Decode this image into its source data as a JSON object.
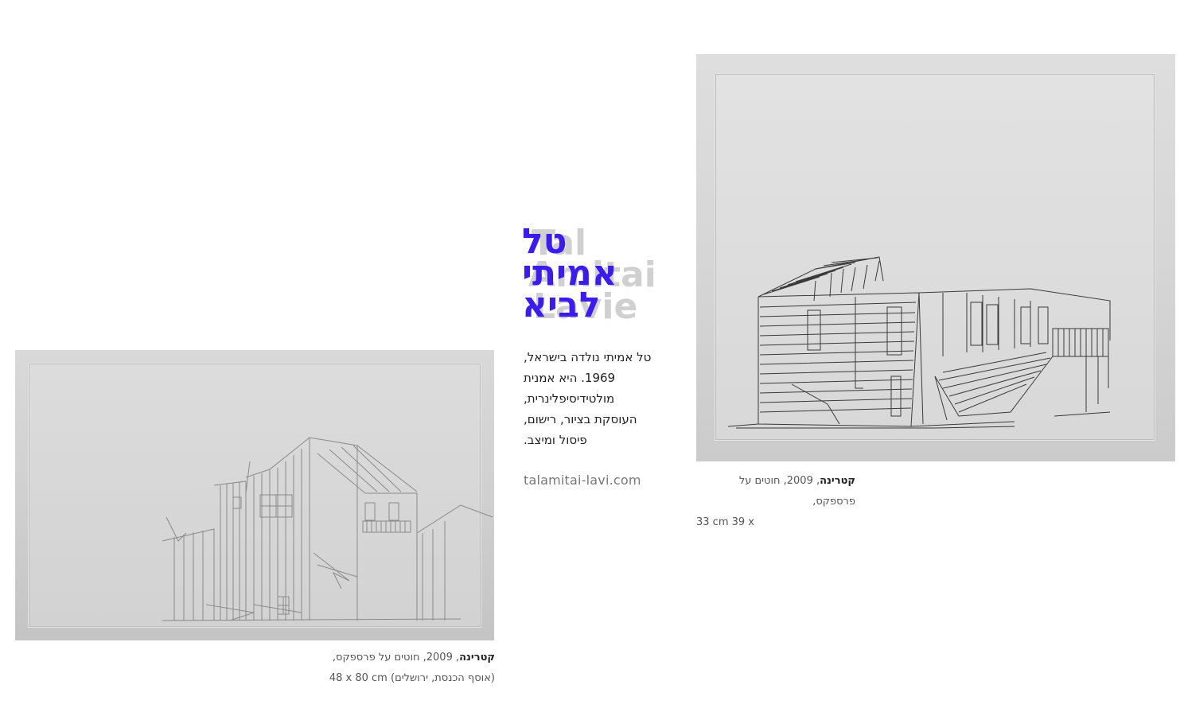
{
  "artist": {
    "name_lines": [
      "טל",
      "אמיתי",
      "לביא"
    ],
    "name_latin_lines": [
      "Tal",
      "Amitai",
      "Lavie"
    ],
    "bio_lines": [
      "טל אמיתי נולדה בישראל,",
      "1969. היא אמנית",
      "מולטידיסיפלינרית,",
      "העוסקת בציור, רישום,",
      "פיסול ומיצב."
    ],
    "website": "talamitai-lavi.com"
  },
  "artworks": [
    {
      "title": "קטרינה",
      "details": ", 2009, חוטים על פרספקס,",
      "size_line": "48 x 80 cm (אוסף הכנסת, ירושלים)"
    },
    {
      "title": "קטרינה",
      "details": ", 2009, חוטים על פרספקס,",
      "size_line": "33 cm 39 x"
    }
  ]
}
